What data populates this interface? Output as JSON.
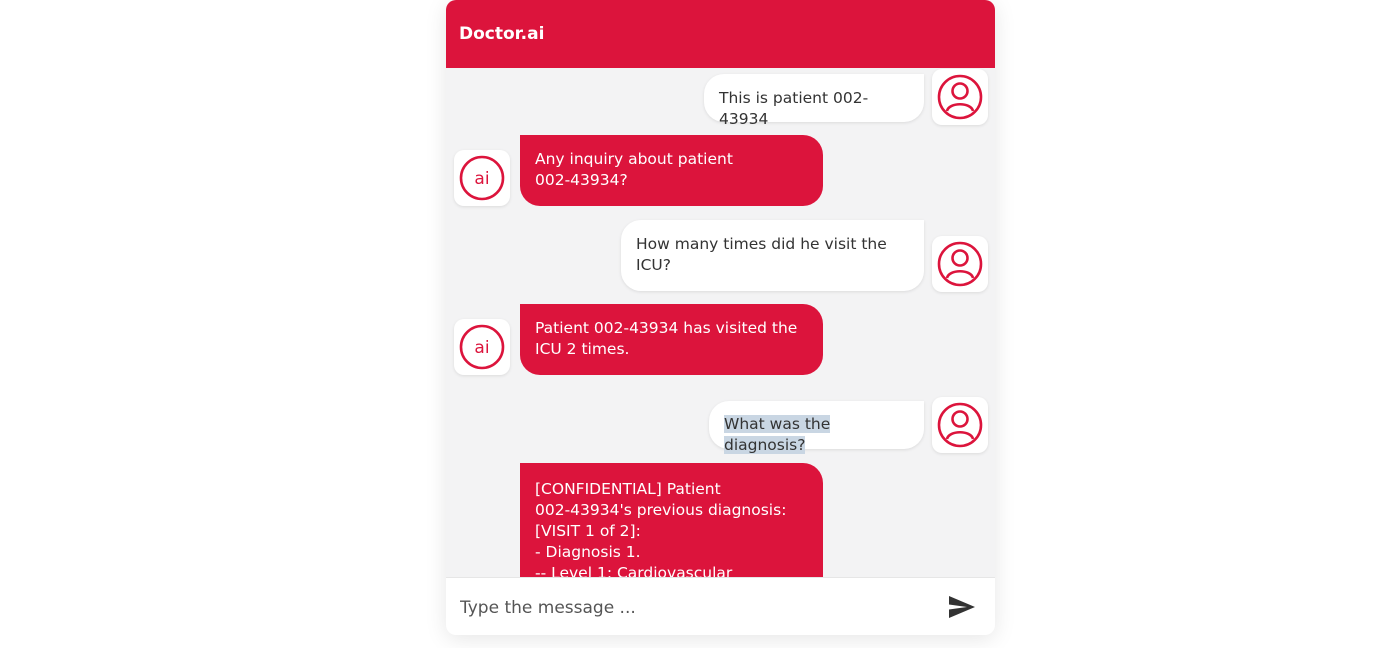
{
  "header": {
    "title": "Doctor.ai"
  },
  "colors": {
    "accent": "#dc143c",
    "chat_background": "#f3f3f4",
    "user_bubble": "#ffffff",
    "selection_highlight": "#c9d6e3"
  },
  "icons": {
    "user_avatar": "user-icon",
    "bot_avatar": "ai-logo",
    "send": "send-icon"
  },
  "bot_avatar_label": "ai",
  "messages": [
    {
      "sender": "user",
      "text": "This is patient 002-43934"
    },
    {
      "sender": "bot",
      "text": "Any inquiry about patient\n002-43934?"
    },
    {
      "sender": "user",
      "text": "How many times did he visit the\nICU?"
    },
    {
      "sender": "bot",
      "text": "Patient 002-43934 has visited the\nICU 2 times."
    },
    {
      "sender": "user",
      "text": "What was the diagnosis?",
      "selected": true
    },
    {
      "sender": "bot",
      "text": "[CONFIDENTIAL] Patient\n002-43934's previous diagnosis:\n[VISIT 1 of 2]:\n- Diagnosis 1.\n-- Level 1: Cardiovascular"
    }
  ],
  "composer": {
    "placeholder": "Type the message ..."
  }
}
